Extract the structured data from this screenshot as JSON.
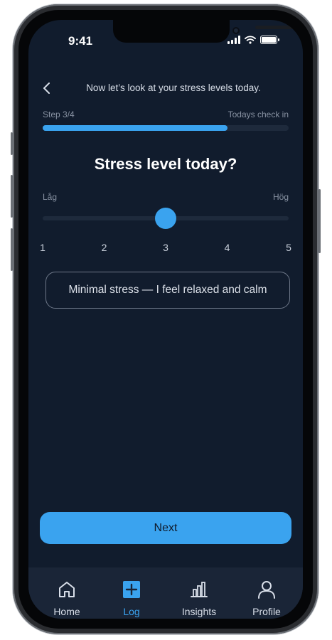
{
  "status_bar": {
    "time": "9:41"
  },
  "header": {
    "title": "Now let’s look at your stress levels today."
  },
  "progress": {
    "step_label": "Step 3/4",
    "right_label": "Todays check in",
    "fraction": 0.75
  },
  "question": {
    "title": "Stress level today?"
  },
  "scale": {
    "low_label": "Låg",
    "high_label": "Hög",
    "ticks": [
      "1",
      "2",
      "3",
      "4",
      "5"
    ],
    "selected_value": 3,
    "min": 1,
    "max": 5
  },
  "description": {
    "text": "Minimal stress — I feel relaxed and calm"
  },
  "next_button": {
    "label": "Next"
  },
  "tabbar": {
    "items": [
      {
        "label": "Home",
        "icon": "home-icon"
      },
      {
        "label": "Log",
        "icon": "plus-square-icon",
        "active": true
      },
      {
        "label": "Insights",
        "icon": "bar-chart-icon"
      },
      {
        "label": "Profile",
        "icon": "user-icon"
      }
    ]
  },
  "colors": {
    "background": "#111c2d",
    "accent": "#3aa3ef",
    "tabbar": "#1a2537"
  }
}
